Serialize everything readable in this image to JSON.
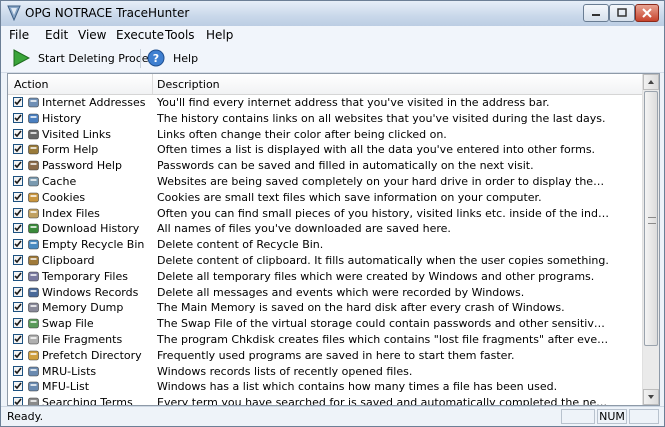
{
  "window": {
    "title": "OPG NOTRACE TraceHunter"
  },
  "menu": [
    "File",
    "Edit",
    "View",
    "Execute",
    "Tools",
    "Help"
  ],
  "toolbar": {
    "start_label": "Start Deleting Process",
    "help_label": "Help"
  },
  "columns": {
    "action": "Action",
    "description": "Description"
  },
  "rows": [
    {
      "name": "Internet Addresses",
      "desc": "You'll find every internet address that you've visited in the address bar.",
      "icon": "internet-addresses-icon",
      "checked": true
    },
    {
      "name": "History",
      "desc": "The history contains links on all websites that you've visited during the last days.",
      "icon": "history-icon",
      "checked": true
    },
    {
      "name": "Visited Links",
      "desc": "Links often change their color after being clicked on.",
      "icon": "link-icon",
      "checked": true
    },
    {
      "name": "Form Help",
      "desc": "Often times a list is displayed with all the data you've entered into other forms.",
      "icon": "form-icon",
      "checked": true
    },
    {
      "name": "Password Help",
      "desc": "Passwords can be saved and filled in automatically on the next visit.",
      "icon": "password-icon",
      "checked": true
    },
    {
      "name": "Cache",
      "desc": "Websites are being saved completely on your hard drive in order to display them faster.",
      "icon": "cache-icon",
      "checked": true
    },
    {
      "name": "Cookies",
      "desc": "Cookies are small text files which save information on your computer.",
      "icon": "cookie-icon",
      "checked": true
    },
    {
      "name": "Index Files",
      "desc": "Often you can find small pieces of you history, visited links etc. inside of the index files (Requires rest...",
      "icon": "index-files-icon",
      "checked": true
    },
    {
      "name": "Download History",
      "desc": "All names of files you've downloaded are saved here.",
      "icon": "download-icon",
      "checked": true
    },
    {
      "name": "Empty Recycle Bin",
      "desc": "Delete content of Recycle Bin.",
      "icon": "recycle-bin-icon",
      "checked": true
    },
    {
      "name": "Clipboard",
      "desc": "Delete content of clipboard. It fills automatically when the user copies something.",
      "icon": "clipboard-icon",
      "checked": true
    },
    {
      "name": "Temporary Files",
      "desc": "Delete all temporary files which were created by Windows and other programs.",
      "icon": "temp-files-icon",
      "checked": true
    },
    {
      "name": "Windows Records",
      "desc": "Delete all messages and events which were recorded by Windows.",
      "icon": "records-icon",
      "checked": true
    },
    {
      "name": "Memory Dump",
      "desc": "The Main Memory is saved on the hard disk after every crash of Windows.",
      "icon": "memory-dump-icon",
      "checked": true
    },
    {
      "name": "Swap File",
      "desc": "The Swap File of the virtual storage could contain passwords and other sensitive data.",
      "icon": "swap-file-icon",
      "checked": true
    },
    {
      "name": "File Fragments",
      "desc": "The program Chkdisk creates files which contains \"lost file fragments\" after every crash.",
      "icon": "file-fragments-icon",
      "checked": true
    },
    {
      "name": "Prefetch Directory",
      "desc": "Frequently used programs are saved in here to start them faster.",
      "icon": "folder-icon",
      "checked": true
    },
    {
      "name": "MRU-Lists",
      "desc": "Windows records lists of recently opened files.",
      "icon": "mru-list-icon",
      "checked": true
    },
    {
      "name": "MFU-List",
      "desc": "Windows has a list which contains how many times a file has been used.",
      "icon": "mfu-list-icon",
      "checked": true
    },
    {
      "name": "Searching Terms",
      "desc": "Every term you have searched for is saved and automatically completed the next time you search for...",
      "icon": "search-terms-icon",
      "checked": true
    }
  ],
  "statusbar": {
    "text": "Ready.",
    "num": "NUM"
  }
}
